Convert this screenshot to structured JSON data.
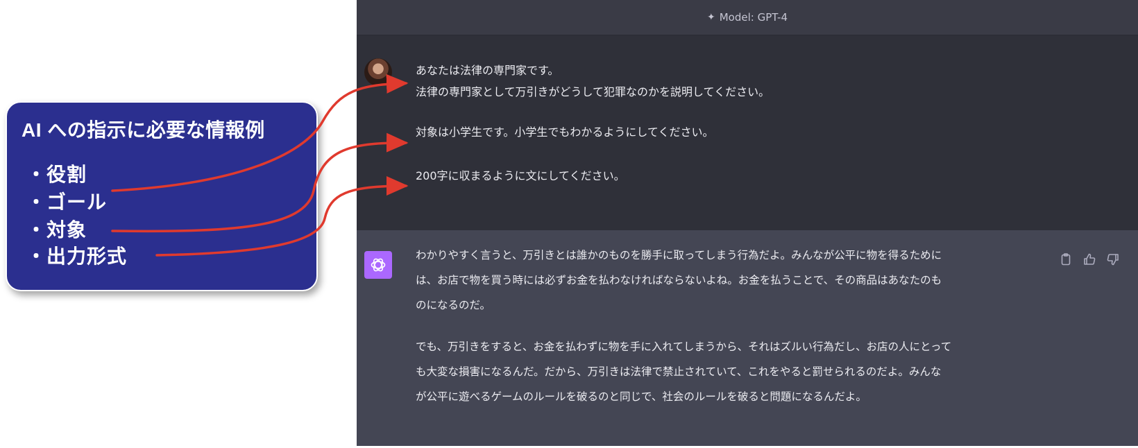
{
  "header": {
    "model_label": "Model: GPT-4"
  },
  "user_message": {
    "lines": [
      "あなたは法律の専門家です。",
      "法律の専門家として万引きがどうして犯罪なのかを説明してください。",
      "対象は小学生です。小学生でもわかるようにしてください。",
      "200字に収まるように文にしてください。"
    ]
  },
  "assistant_message": {
    "lines": [
      "わかりやすく言うと、万引きとは誰かのものを勝手に取ってしまう行為だよ。みんなが公平に物を得るために",
      "は、お店で物を買う時には必ずお金を払わなければならないよね。お金を払うことで、その商品はあなたのも",
      "のになるのだ。",
      "でも、万引きをすると、お金を払わずに物を手に入れてしまうから、それはズルい行為だし、お店の人にとって",
      "も大変な損害になるんだ。だから、万引きは法律で禁止されていて、これをやると罰せられるのだよ。みんな",
      "が公平に遊べるゲームのルールを破るのと同じで、社会のルールを破ると問題になるんだよ。"
    ]
  },
  "callout": {
    "title": "AI への指示に必要な情報例",
    "items": [
      "・役割",
      "・ゴール",
      "・対象",
      "・出力形式"
    ]
  },
  "icons": {
    "model": "sparkle-icon",
    "copy": "clipboard-icon",
    "thumbs_up": "thumbs-up-icon",
    "thumbs_down": "thumbs-down-icon"
  },
  "colors": {
    "chat_bg": "#343541",
    "user_bg": "#2f3039",
    "assistant_bg": "#444654",
    "gpt_logo": "#ab68ff",
    "callout_bg": "#2b2f8f",
    "arrow": "#e03a2e"
  }
}
